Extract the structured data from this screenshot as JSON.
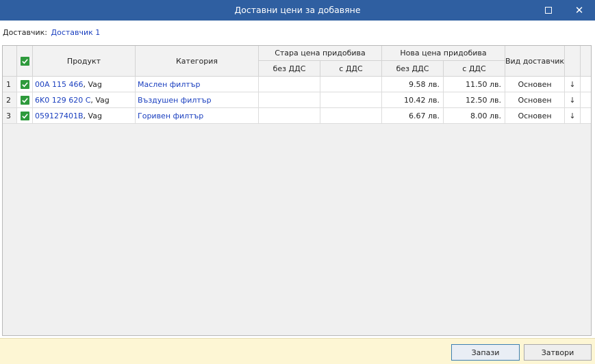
{
  "window": {
    "title": "Доставни цени за добавяне"
  },
  "supplier": {
    "label": "Доставчик:",
    "value": "Доставчик 1"
  },
  "columns": {
    "product": "Продукт",
    "category": "Категория",
    "old_price": "Стара цена придобива",
    "new_price": "Нова цена придобива",
    "supplier_type": "Вид доставчик",
    "no_vat": "без ДДС",
    "with_vat": "с ДДС"
  },
  "rows": [
    {
      "num": "1",
      "checked": true,
      "product_code": "00A 115 466",
      "product_suffix": ", Vag",
      "category": "Маслен филтър",
      "old_no_vat": "",
      "old_with_vat": "",
      "new_no_vat": "9.58 лв.",
      "new_with_vat": "11.50 лв.",
      "supplier_type": "Основен",
      "arrow": "↓"
    },
    {
      "num": "2",
      "checked": true,
      "product_code": "6K0 129 620 C",
      "product_suffix": ", Vag",
      "category": "Въздушен филтър",
      "old_no_vat": "",
      "old_with_vat": "",
      "new_no_vat": "10.42 лв.",
      "new_with_vat": "12.50 лв.",
      "supplier_type": "Основен",
      "arrow": "↓"
    },
    {
      "num": "3",
      "checked": true,
      "product_code": "059127401B",
      "product_suffix": ", Vag",
      "category": "Горивен филтър",
      "old_no_vat": "",
      "old_with_vat": "",
      "new_no_vat": "6.67 лв.",
      "new_with_vat": "8.00 лв.",
      "supplier_type": "Основен",
      "arrow": "↓"
    }
  ],
  "buttons": {
    "save": "Запази",
    "close": "Затвори"
  },
  "colors": {
    "titlebar": "#2f5fa1",
    "link": "#1a3fbf",
    "check": "#2e9a3c",
    "footer": "#fdf6d4"
  }
}
